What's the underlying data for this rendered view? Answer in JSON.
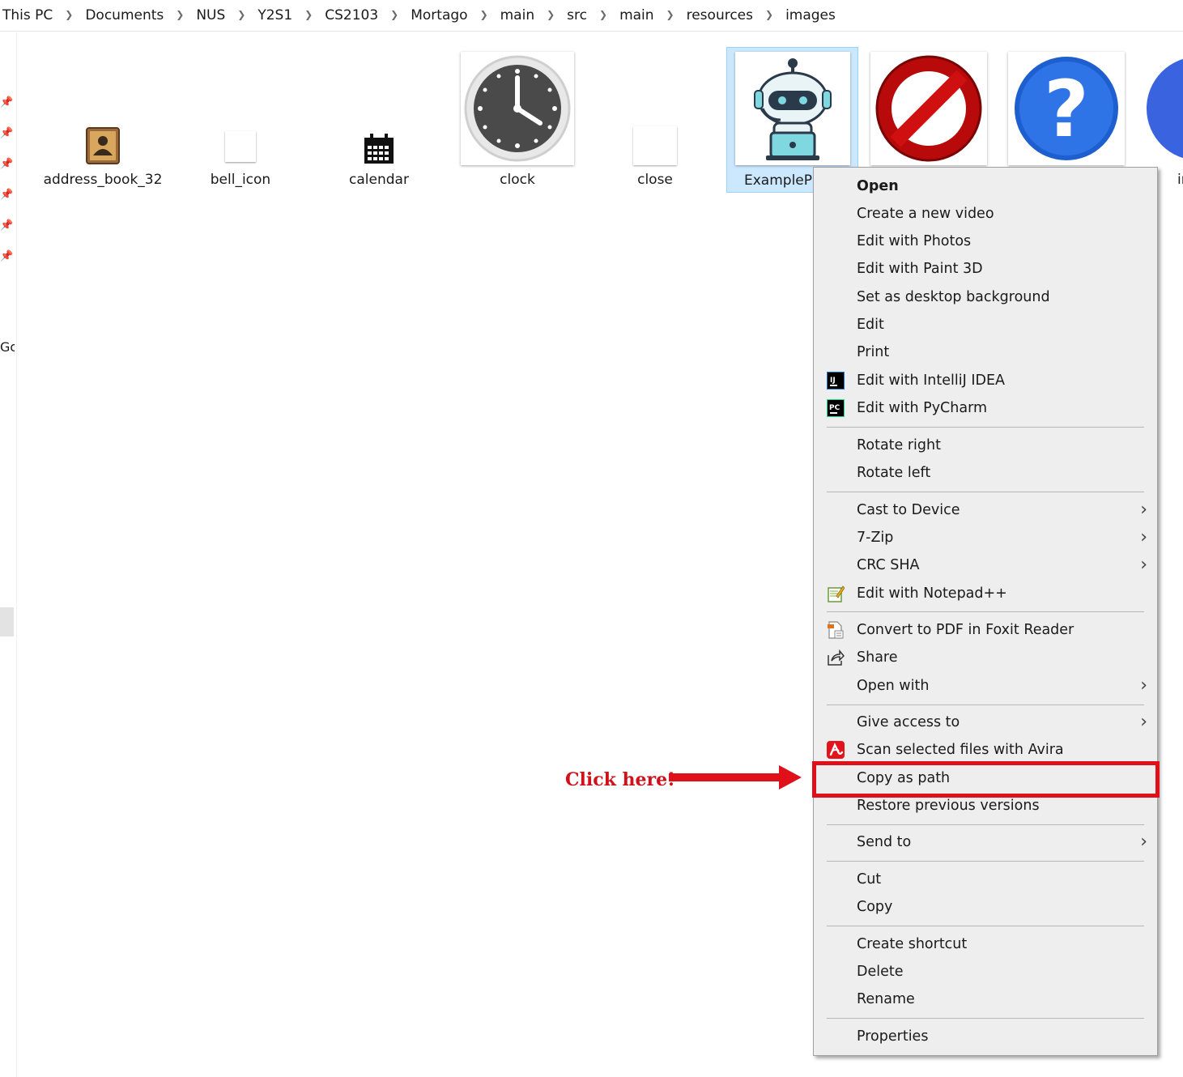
{
  "breadcrumb": [
    "This PC",
    "Documents",
    "NUS",
    "Y2S1",
    "CS2103",
    "Mortago",
    "main",
    "src",
    "main",
    "resources",
    "images"
  ],
  "nav": {
    "partial_label": "Go"
  },
  "files": [
    {
      "name": "address_book_32"
    },
    {
      "name": "bell_icon"
    },
    {
      "name": "calendar"
    },
    {
      "name": "clock"
    },
    {
      "name": "close"
    },
    {
      "name": "ExamplePl"
    },
    {
      "name": ""
    },
    {
      "name": ""
    },
    {
      "name": "in"
    }
  ],
  "context_menu": {
    "items": [
      {
        "label": "Open",
        "bold": true
      },
      {
        "label": "Create a new video"
      },
      {
        "label": "Edit with Photos"
      },
      {
        "label": "Edit with Paint 3D"
      },
      {
        "label": "Set as desktop background"
      },
      {
        "label": "Edit"
      },
      {
        "label": "Print"
      },
      {
        "label": "Edit with IntelliJ IDEA",
        "icon": "intellij-icon"
      },
      {
        "label": "Edit with PyCharm",
        "icon": "pycharm-icon"
      },
      {
        "label": "Rotate right"
      },
      {
        "label": "Rotate left"
      },
      {
        "label": "Cast to Device",
        "submenu": true
      },
      {
        "label": "7-Zip",
        "submenu": true
      },
      {
        "label": "CRC SHA",
        "submenu": true
      },
      {
        "label": "Edit with Notepad++",
        "icon": "notepadpp-icon"
      },
      {
        "label": "Convert to PDF in Foxit Reader",
        "icon": "foxit-icon"
      },
      {
        "label": "Share",
        "icon": "share-icon"
      },
      {
        "label": "Open with",
        "submenu": true
      },
      {
        "label": "Give access to",
        "submenu": true
      },
      {
        "label": "Scan selected files with Avira",
        "icon": "avira-icon"
      },
      {
        "label": "Copy as path",
        "highlighted": true
      },
      {
        "label": "Restore previous versions"
      },
      {
        "label": "Send to",
        "submenu": true
      },
      {
        "label": "Cut"
      },
      {
        "label": "Copy"
      },
      {
        "label": "Create shortcut"
      },
      {
        "label": "Delete"
      },
      {
        "label": "Rename"
      },
      {
        "label": "Properties"
      }
    ]
  },
  "annotation": {
    "text": "Click here!",
    "color": "#d0111a"
  },
  "colors": {
    "selection_bg": "#cce8ff",
    "menu_bg": "#eeeeee",
    "highlight": "#e0101a"
  }
}
